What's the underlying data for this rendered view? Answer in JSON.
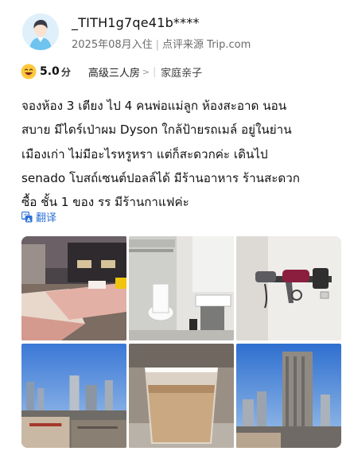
{
  "user": {
    "name": "_TITH1g7qe41b****",
    "stay_date": "2025年08月入住",
    "source": "点评来源 Trip.com",
    "separator": "|"
  },
  "rating": {
    "score": "5.0",
    "unit": "分",
    "room_type": "高级三人房",
    "chevron": ">",
    "divider": "|",
    "traveler_type": "家庭亲子",
    "emoji_icon": "grinning-face-icon"
  },
  "review": {
    "lines": [
      "จองห้อง 3 เตียง ไป 4 คนพ่อแม่ลูก ห้องสะอาด นอน",
      "สบาย มีไดร์เป่าผม Dyson ใกล้ป้ายรถเมล์ อยู่ในย่าน",
      "เมืองเก่า ไม่มีอะไรหรูหรา แต่ก็สะดวกค่ะ เดินไป",
      "senado โบสถ์เซนต์ปอลล์ได้ มีร้านอาหาร ร้านสะดวก",
      "ซื้อ ชั้น 1 ของ รร มีร้านกาแฟค่ะ"
    ]
  },
  "translate": {
    "label": "翻译",
    "icon": "translate-icon"
  },
  "photos": [
    {
      "name": "photo-bedroom",
      "subject": "hotel bedroom with beds"
    },
    {
      "name": "photo-bathroom-toilet",
      "subject": "bathroom toilet and sink"
    },
    {
      "name": "photo-hairdryer",
      "subject": "wall-mounted hair dryers"
    },
    {
      "name": "photo-city-view",
      "subject": "city skyline view"
    },
    {
      "name": "photo-iced-coffee",
      "subject": "iced coffee cup"
    },
    {
      "name": "photo-building-view",
      "subject": "tall building view"
    }
  ],
  "colors": {
    "link_blue": "#2a6fd6",
    "muted_text": "#6b6b6b",
    "emoji_yellow": "#ffc83d"
  }
}
